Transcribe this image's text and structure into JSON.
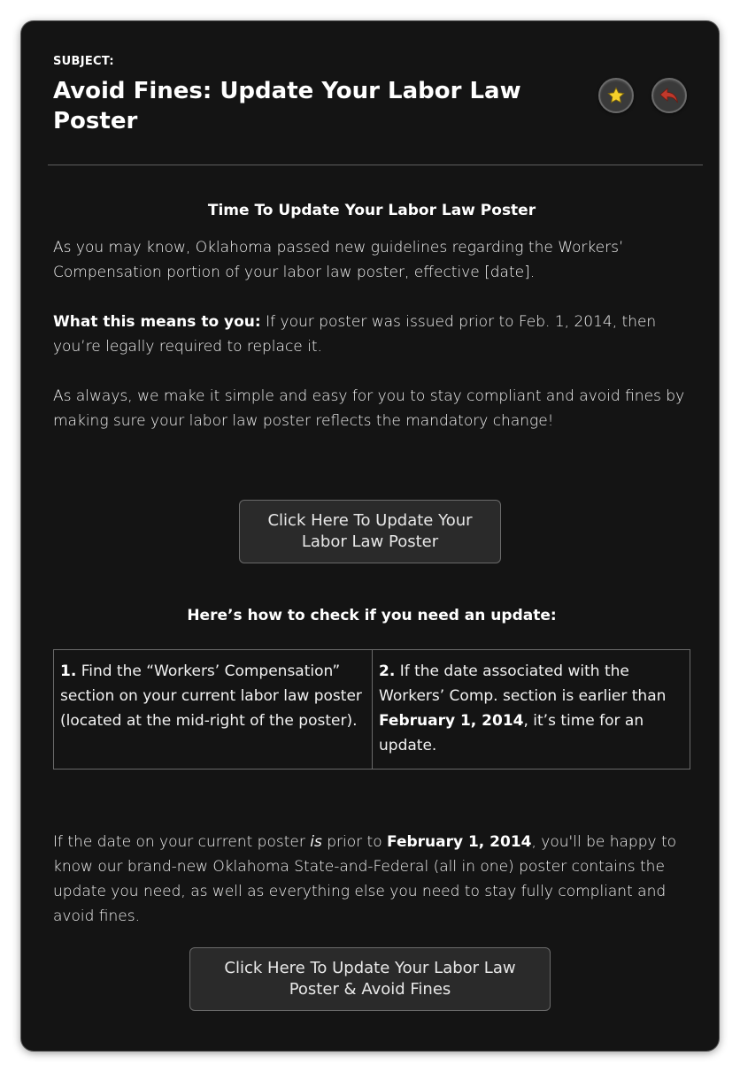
{
  "email": {
    "subject_label": "SUBJECT:",
    "subject_title": "Avoid Fines: Update Your Labor Law Poster",
    "icons": {
      "star": "star-icon",
      "reply": "reply-arrow-icon"
    },
    "colors": {
      "background": "#141414",
      "star": "#f5d02a",
      "reply": "#c0392b"
    }
  },
  "body": {
    "heading": "Time To Update Your Labor Law Poster",
    "intro": "As you may know, Oklahoma passed new guidelines regarding the Workers’ Compensation portion of your labor law poster, effective [date].",
    "means_label": "What this means to you:",
    "means_text": " If your poster was issued prior to Feb. 1, 2014, then you’re legally required to replace it.",
    "always_text": "As always, we make it simple and easy for you to stay compliant and avoid fines by making sure your labor law poster reflects the mandatory change!",
    "cta1": "Click Here To Update Your Labor Law Poster",
    "check_heading": "Here’s how to check if you need an update:",
    "step1_num": "1.",
    "step1_text": " Find the “Workers’ Compensation” section on your current labor law poster (located at the mid-right of the poster).",
    "step2_num": "2.",
    "step2_text_a": " If the date associated with the Workers’ Comp. section is earlier than ",
    "step2_date": "February 1, 2014",
    "step2_text_b": ", it’s time for an update.",
    "final_a": "If the date on your current poster ",
    "final_is": "is",
    "final_b": " prior to ",
    "final_date": "February 1, 2014",
    "final_c": ", you'll be happy to know our brand-new Oklahoma State-and-Federal (all in one) poster contains the update you need, as well as everything else you need to stay fully compliant and avoid fines.",
    "cta2": "Click Here To Update Your Labor Law Poster & Avoid Fines"
  }
}
